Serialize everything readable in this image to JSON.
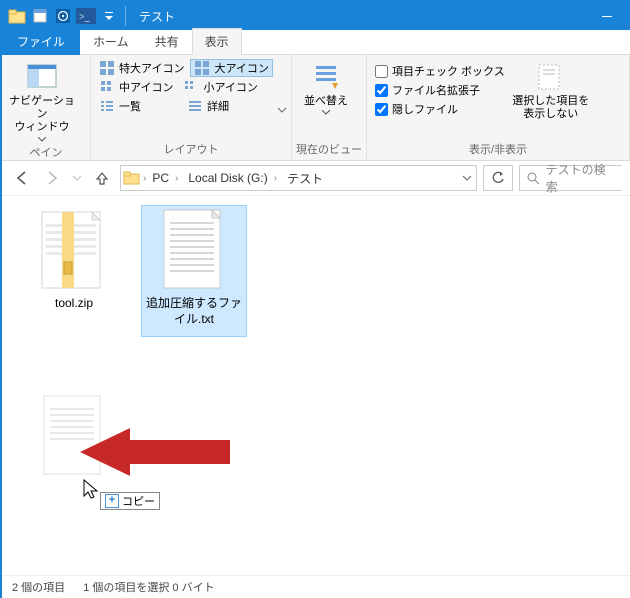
{
  "title": "テスト",
  "tabs": {
    "file": "ファイル",
    "home": "ホーム",
    "share": "共有",
    "view": "表示"
  },
  "ribbon": {
    "pane": {
      "label": "ペイン",
      "nav": "ナビゲーション\nウィンドウ"
    },
    "layout": {
      "label": "レイアウト",
      "xl": "特大アイコン",
      "l": "大アイコン",
      "m": "中アイコン",
      "s": "小アイコン",
      "list": "一覧",
      "detail": "詳細"
    },
    "sort": {
      "label": "現在のビュー",
      "sort": "並べ替え"
    },
    "show": {
      "label": "表示/非表示",
      "check": "項目チェック ボックス",
      "ext": "ファイル名拡張子",
      "hidden": "隠しファイル",
      "hidesel": "選択した項目を\n表示しない"
    }
  },
  "checks": {
    "check": false,
    "ext": true,
    "hidden": true
  },
  "breadcrumb": {
    "pc": "PC",
    "disk": "Local Disk (G:)",
    "folder": "テスト"
  },
  "search": {
    "placeholder": "テストの検索"
  },
  "files": {
    "f1": "tool.zip",
    "f2": "追加圧縮するファイル.txt"
  },
  "copy": "コピー",
  "status": {
    "count": "2 個の項目",
    "sel": "1 個の項目を選択 0 バイト"
  }
}
